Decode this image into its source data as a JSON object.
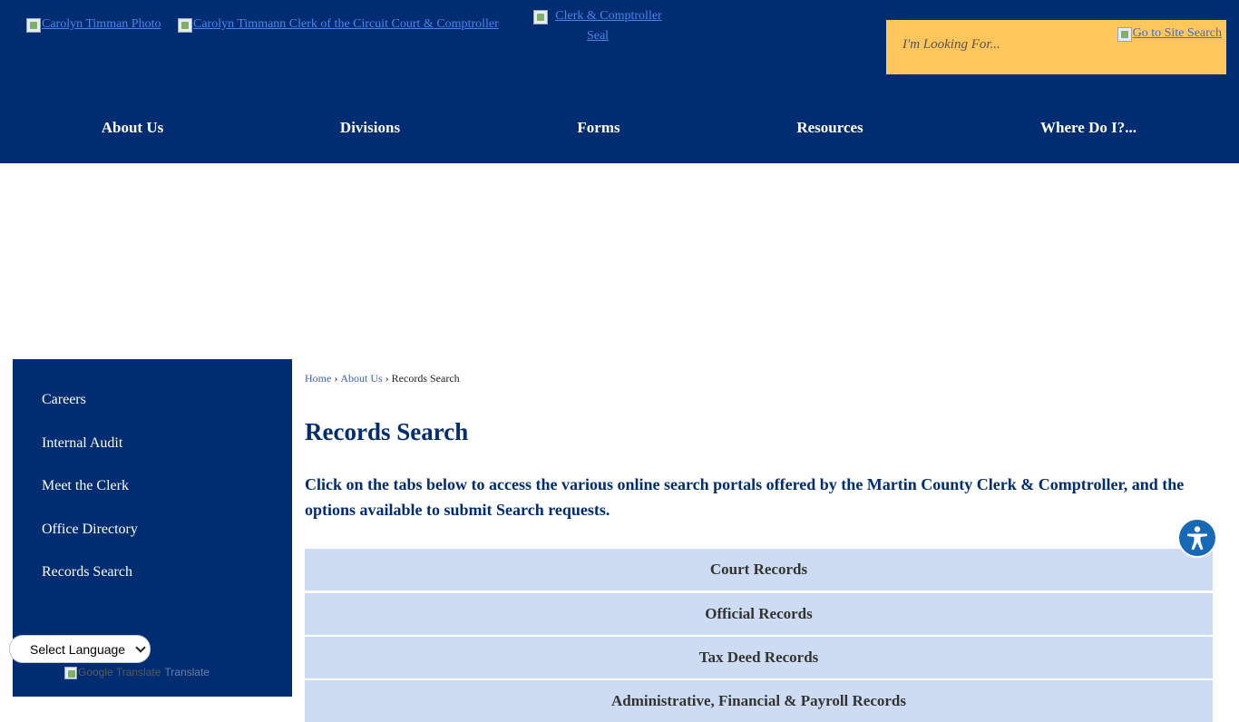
{
  "header": {
    "logos": [
      {
        "alt": "Carolyn Timman Photo"
      },
      {
        "alt": "Carolyn Timmann Clerk of the Circuit Court & Comptroller"
      },
      {
        "alt": "Clerk & Comptroller Seal"
      }
    ],
    "search": {
      "placeholder": "I'm Looking For...",
      "button_alt": "Go to Site Search"
    }
  },
  "nav": {
    "items": [
      {
        "label": "About Us"
      },
      {
        "label": "Divisions"
      },
      {
        "label": "Forms"
      },
      {
        "label": "Resources"
      },
      {
        "label": "Where Do I?..."
      }
    ]
  },
  "sidebar": {
    "items": [
      {
        "label": "Careers"
      },
      {
        "label": "Internal Audit"
      },
      {
        "label": "Meet the Clerk"
      },
      {
        "label": "Office Directory"
      },
      {
        "label": "Records Search"
      }
    ]
  },
  "translate": {
    "select_label": "Select Language",
    "powered_alt": "Google Translate",
    "powered_link": "Translate"
  },
  "breadcrumb": {
    "items": [
      "Home",
      "About Us"
    ],
    "current": "Records Search",
    "separator": "›"
  },
  "main": {
    "title": "Records Search",
    "intro": "Click on the tabs below to access the various online search portals offered by the Martin County Clerk & Comptroller, and the options available to submit Search requests.",
    "tabs": [
      {
        "label": "Court Records"
      },
      {
        "label": "Official Records"
      },
      {
        "label": "Tax Deed Records"
      },
      {
        "label": "Administrative, Financial & Payroll Records"
      }
    ]
  },
  "accessibility": {
    "icon": "accessibility-icon"
  },
  "colors": {
    "header_bg": "#002c71",
    "search_bg": "#ffc65c",
    "tab_bg": "#cddcf3",
    "title_color": "#002c71",
    "a11y_bg": "#1769b6"
  }
}
